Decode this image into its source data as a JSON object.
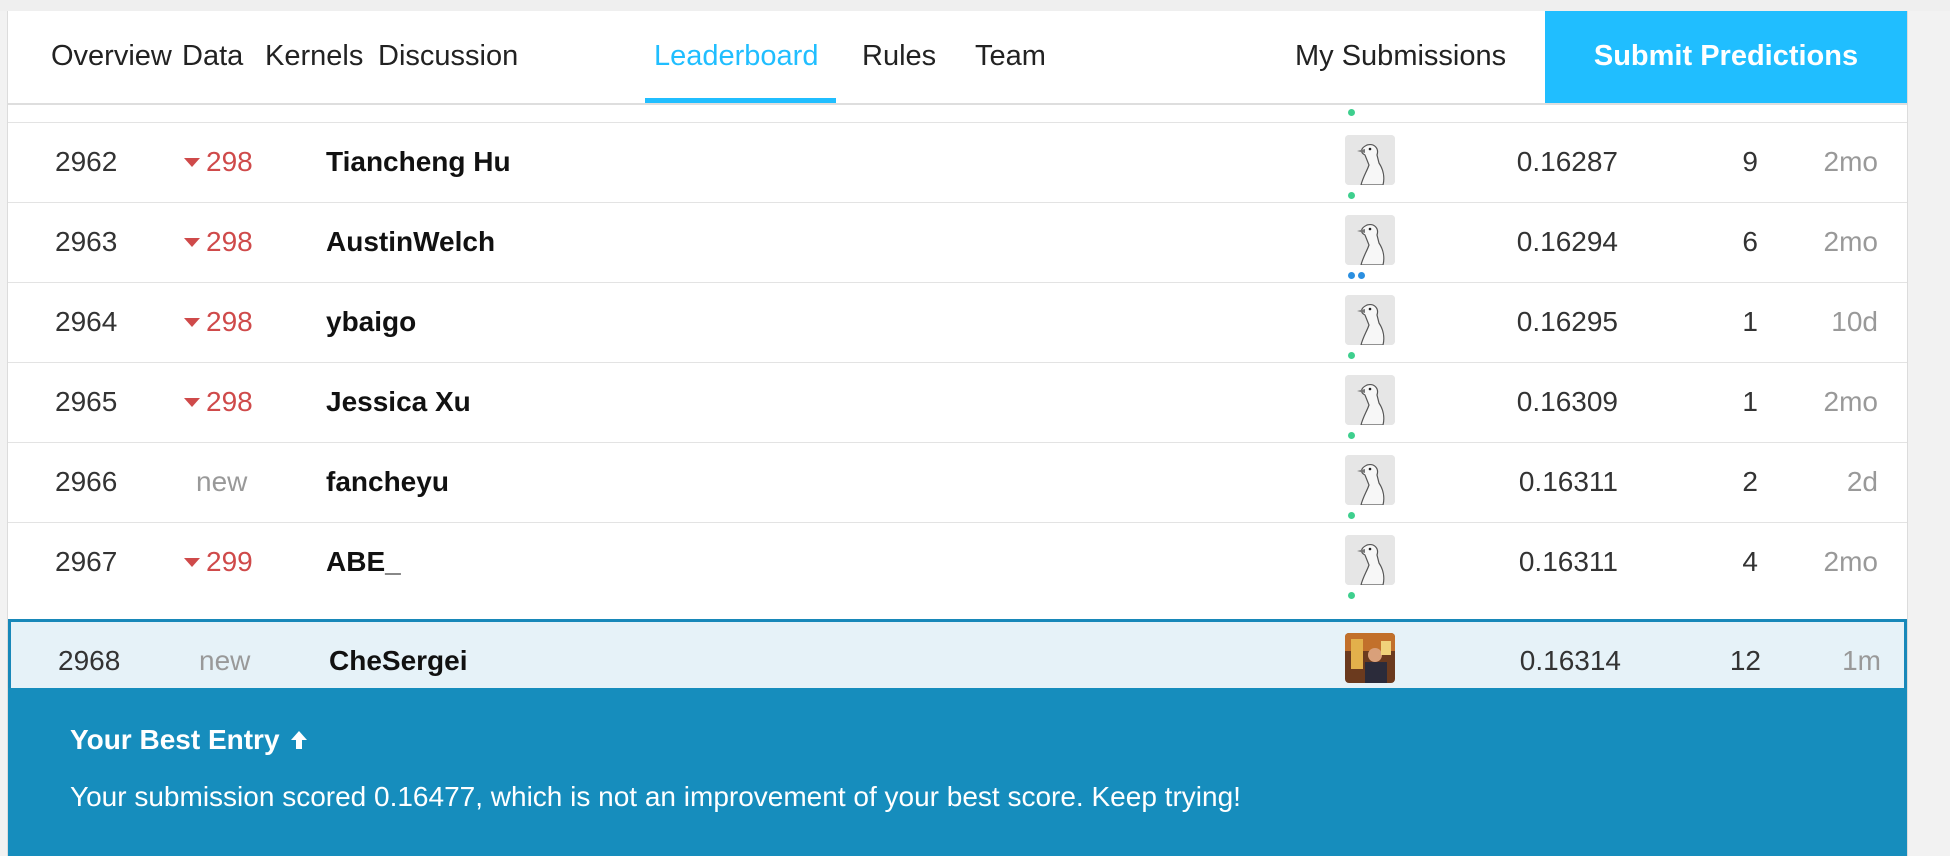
{
  "nav": {
    "tabs": [
      "Overview",
      "Data",
      "Kernels",
      "Discussion",
      "Leaderboard",
      "Rules",
      "Team"
    ],
    "active_tab": "Leaderboard",
    "my_submissions": "My Submissions",
    "submit_button": "Submit Predictions"
  },
  "leaderboard": {
    "rows": [
      {
        "rank": "2962",
        "change": "298",
        "change_dir": "down",
        "name": "Tiancheng Hu",
        "score": "0.16287",
        "entries": "9",
        "last": "2mo"
      },
      {
        "rank": "2963",
        "change": "298",
        "change_dir": "down",
        "name": "AustinWelch",
        "score": "0.16294",
        "entries": "6",
        "last": "2mo"
      },
      {
        "rank": "2964",
        "change": "298",
        "change_dir": "down",
        "name": "ybaigo",
        "score": "0.16295",
        "entries": "1",
        "last": "10d"
      },
      {
        "rank": "2965",
        "change": "298",
        "change_dir": "down",
        "name": "Jessica Xu",
        "score": "0.16309",
        "entries": "1",
        "last": "2mo"
      },
      {
        "rank": "2966",
        "change": "new",
        "change_dir": "new",
        "name": "fancheyu",
        "score": "0.16311",
        "entries": "2",
        "last": "2d"
      },
      {
        "rank": "2967",
        "change": "299",
        "change_dir": "down",
        "name": "ABE_",
        "score": "0.16311",
        "entries": "4",
        "last": "2mo"
      },
      {
        "rank": "2968",
        "change": "new",
        "change_dir": "new",
        "name": "CheSergei",
        "score": "0.16314",
        "entries": "12",
        "last": "1m"
      }
    ]
  },
  "banner": {
    "title": "Your Best Entry",
    "message": "Your submission scored 0.16477, which is not an improvement of your best score. Keep trying!"
  },
  "colors": {
    "accent": "#20beff",
    "down": "#cf4a4a",
    "banner": "#168dbd",
    "highlight_row": "#e6f2f8"
  }
}
